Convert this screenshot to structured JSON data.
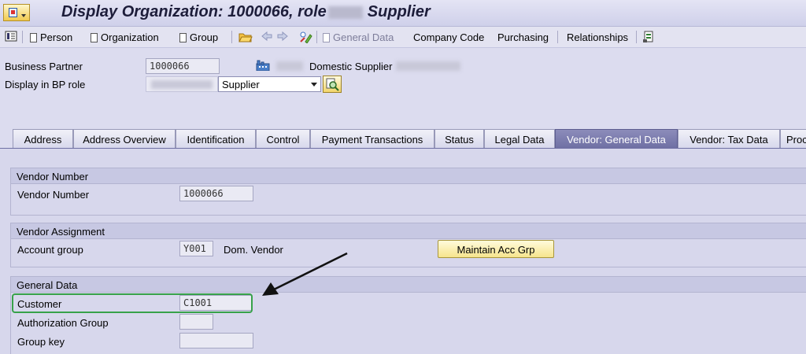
{
  "title": {
    "text_before": "Display Organization: 1000066, role",
    "text_after": "Supplier"
  },
  "toolbar": {
    "person": "Person",
    "organization": "Organization",
    "group": "Group",
    "general_data": "General Data",
    "company_code": "Company Code",
    "purchasing": "Purchasing",
    "relationships": "Relationships"
  },
  "header": {
    "bp_label": "Business Partner",
    "bp_value": "1000066",
    "bp_desc": "Domestic Supplier",
    "role_label": "Display in BP role",
    "role_value": "Supplier"
  },
  "tabs": [
    {
      "label": "Address"
    },
    {
      "label": "Address Overview"
    },
    {
      "label": "Identification"
    },
    {
      "label": "Control"
    },
    {
      "label": "Payment Transactions"
    },
    {
      "label": "Status"
    },
    {
      "label": "Legal Data"
    },
    {
      "label": "Vendor: General Data"
    },
    {
      "label": "Vendor: Tax Data"
    },
    {
      "label": "Proc"
    }
  ],
  "vendor_number_group": {
    "title": "Vendor Number",
    "label": "Vendor Number",
    "value": "1000066"
  },
  "vendor_assignment_group": {
    "title": "Vendor Assignment",
    "account_group_label": "Account group",
    "account_group_value": "Y001",
    "account_group_desc": "Dom. Vendor",
    "maintain_button": "Maintain Acc Grp"
  },
  "general_data_group": {
    "title": "General Data",
    "customer_label": "Customer",
    "customer_value": "C1001",
    "auth_group_label": "Authorization Group",
    "auth_group_value": "",
    "group_key_label": "Group key",
    "group_key_value": ""
  },
  "colors": {
    "active_tab": "#7c7db0",
    "highlight": "#37a24a",
    "background": "#d7d7ec"
  }
}
